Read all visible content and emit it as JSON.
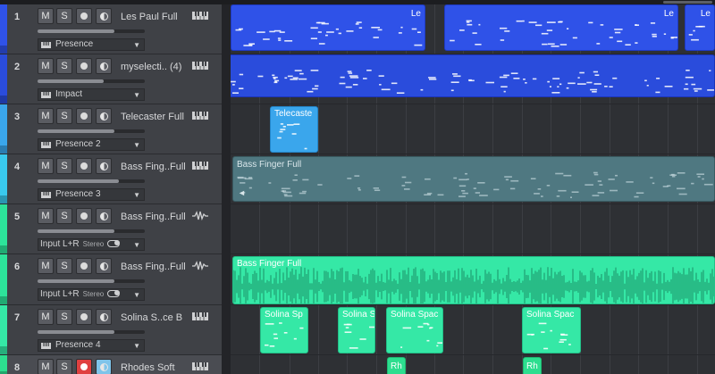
{
  "tracks": [
    {
      "number": "1",
      "mute": "M",
      "solo": "S",
      "name": "Les Paul Full",
      "type": "instrument",
      "selector": {
        "label": "Presence",
        "kind": "instrument"
      },
      "color": "#2f52e8",
      "fader": 0.72
    },
    {
      "number": "2",
      "mute": "M",
      "solo": "S",
      "name": "myselecti.. (4)",
      "type": "instrument",
      "selector": {
        "label": "Impact",
        "kind": "instrument"
      },
      "color": "#2a4cdc",
      "fader": 0.62
    },
    {
      "number": "3",
      "mute": "M",
      "solo": "S",
      "name": "Telecaster Full",
      "type": "instrument",
      "selector": {
        "label": "Presence 2",
        "kind": "instrument"
      },
      "color": "#3aa6ec",
      "fader": 0.72
    },
    {
      "number": "4",
      "mute": "M",
      "solo": "S",
      "name": "Bass Fing..Full",
      "type": "instrument",
      "selector": {
        "label": "Presence 3",
        "kind": "instrument"
      },
      "color": "#39c9ee",
      "fader": 0.76
    },
    {
      "number": "5",
      "mute": "M",
      "solo": "S",
      "name": "Bass Fing..Full",
      "type": "audio",
      "selector": {
        "label": "Input L+R",
        "stereo": "Stereo",
        "kind": "input"
      },
      "color": "#2de39a",
      "fader": 0.72
    },
    {
      "number": "6",
      "mute": "M",
      "solo": "S",
      "name": "Bass Fing..Full",
      "type": "audio",
      "selector": {
        "label": "Input L+R",
        "stereo": "Stereo",
        "kind": "input"
      },
      "color": "#2de39a",
      "fader": 0.72
    },
    {
      "number": "7",
      "mute": "M",
      "solo": "S",
      "name": "Solina S..ce B",
      "type": "instrument",
      "selector": {
        "label": "Presence 4",
        "kind": "instrument"
      },
      "color": "#35e8a6",
      "fader": 0.72
    },
    {
      "number": "8",
      "mute": "M",
      "solo": "S",
      "name": "Rhodes Soft",
      "type": "instrument",
      "selector": {
        "label": "",
        "kind": "instrument"
      },
      "color": "#2dde8f",
      "fader": 0.72,
      "record_armed": true,
      "monitor_on": true,
      "selected": true
    }
  ],
  "clips": [
    {
      "track": 1,
      "label": "Le",
      "style": "blue",
      "notes": true
    },
    {
      "track": 1,
      "label": "Le",
      "style": "blue",
      "notes": true
    },
    {
      "track": 1,
      "label": "Le",
      "style": "blue",
      "notes": true
    },
    {
      "track": 2,
      "label": "",
      "style": "blue2",
      "notes": true
    },
    {
      "track": 3,
      "label": "Telecaste",
      "style": "sky",
      "notes": true
    },
    {
      "track": 4,
      "label": "Bass Finger Full",
      "style": "teal",
      "notes": true
    },
    {
      "track": 6,
      "label": "Bass Finger Full",
      "style": "mint",
      "wave": true
    },
    {
      "track": 7,
      "label": "Solina Sp",
      "style": "mint",
      "notes": true
    },
    {
      "track": 7,
      "label": "Solina S",
      "style": "mint",
      "notes": true
    },
    {
      "track": 7,
      "label": "Solina Spac",
      "style": "mint",
      "notes": true
    },
    {
      "track": 7,
      "label": "Solina Spac",
      "style": "mint",
      "notes": true
    },
    {
      "track": 8,
      "label": "Rh",
      "style": "green",
      "notes": false
    },
    {
      "track": 8,
      "label": "Rh",
      "style": "green",
      "notes": false
    }
  ]
}
